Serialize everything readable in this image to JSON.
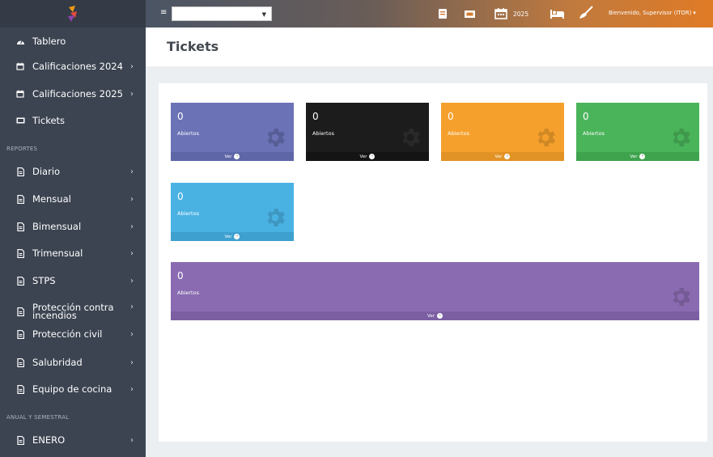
{
  "sidebar": {
    "items": [
      {
        "label": "Tablero",
        "icon": "dashboard-icon"
      },
      {
        "label": "Calificaciones 2024",
        "icon": "calendar-icon"
      },
      {
        "label": "Calificaciones 2025",
        "icon": "calendar-icon"
      },
      {
        "label": "Tickets",
        "icon": "ticket-icon"
      },
      {
        "label": "Diario",
        "icon": "document-icon"
      },
      {
        "label": "Mensual",
        "icon": "document-icon"
      },
      {
        "label": "Bimensual",
        "icon": "document-icon"
      },
      {
        "label": "Trimensual",
        "icon": "document-icon"
      },
      {
        "label": "STPS",
        "icon": "document-icon"
      },
      {
        "label": "Protección contra incendios",
        "icon": "document-icon"
      },
      {
        "label": "Protección civil",
        "icon": "document-icon"
      },
      {
        "label": "Salubridad",
        "icon": "document-icon"
      },
      {
        "label": "Equipo de cocina",
        "icon": "document-icon"
      },
      {
        "label": "ENERO",
        "icon": "document-icon"
      }
    ],
    "sections": {
      "reportes": "REPORTES",
      "anual": "ANUAL Y SEMESTRAL"
    }
  },
  "topbar": {
    "hamburger": "≡",
    "year": "2025",
    "user": "Bienvenido, Supervisor (ITOR) ▾",
    "select_value": ""
  },
  "main": {
    "title": "Tickets"
  },
  "cards": [
    {
      "value": "0",
      "label": "Abiertos",
      "footer": "Ver",
      "color": "#6b72b6",
      "foot_color": "#5f66a8"
    },
    {
      "value": "0",
      "label": "Abiertos",
      "footer": "Ver",
      "color": "#1c1c1c",
      "foot_color": "#141414"
    },
    {
      "value": "0",
      "label": "Abiertos",
      "footer": "Ver",
      "color": "#f5a02c",
      "foot_color": "#e29325"
    },
    {
      "value": "0",
      "label": "Abiertos",
      "footer": "Ver",
      "color": "#4ab45a",
      "foot_color": "#3fa34e"
    },
    {
      "value": "0",
      "label": "Abiertos",
      "footer": "Ver",
      "color": "#4ab2e3",
      "foot_color": "#3ea0cf"
    },
    {
      "value": "0",
      "label": "Abiertos",
      "footer": "Ver",
      "color": "#8a6bb1",
      "foot_color": "#7c5fa2"
    }
  ]
}
